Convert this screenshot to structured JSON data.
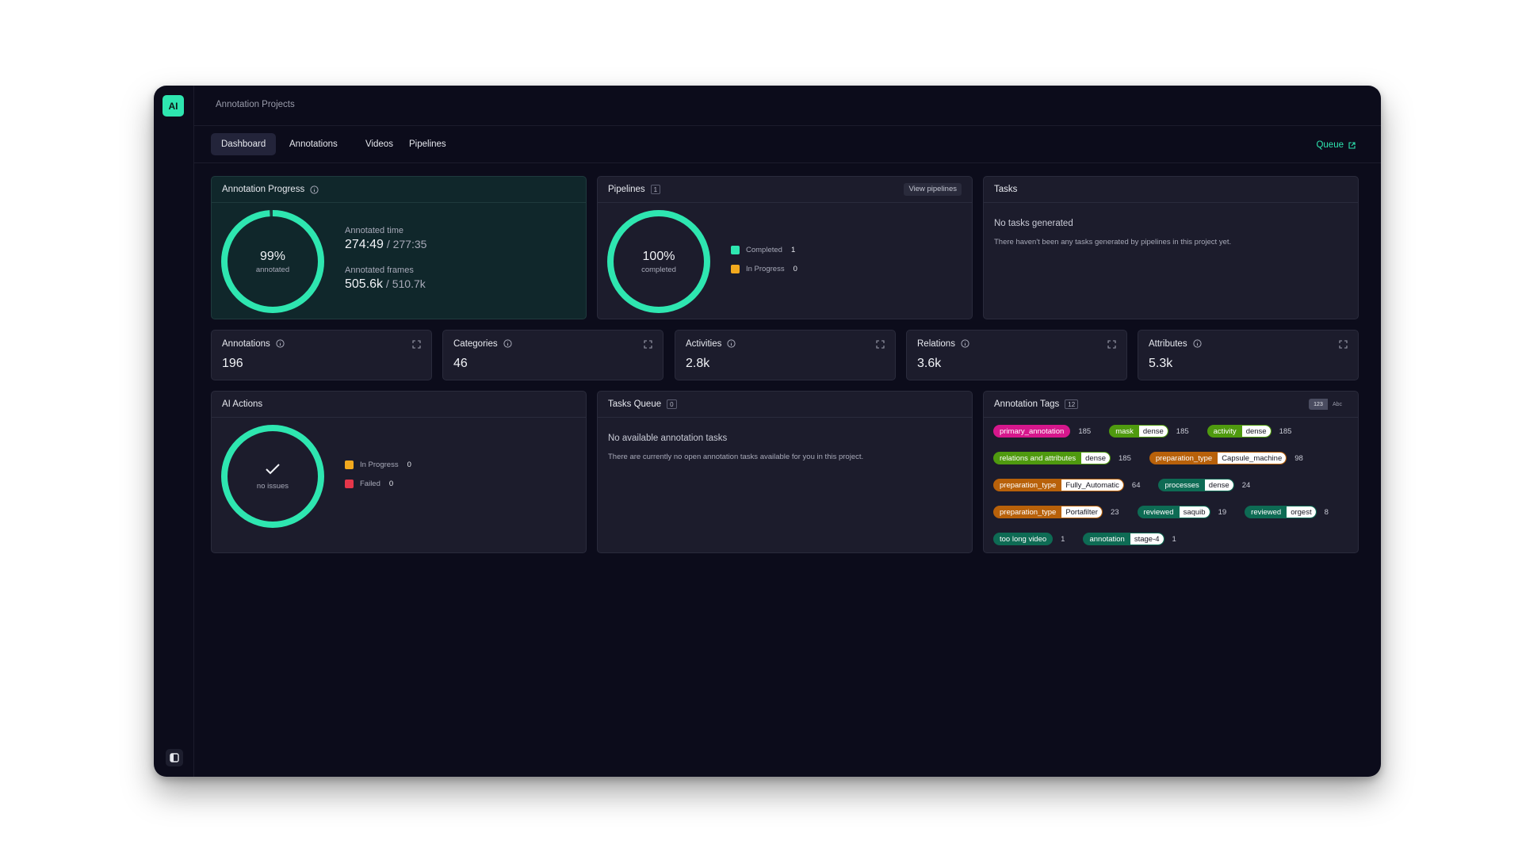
{
  "app": {
    "logo_text": "AI",
    "breadcrumb": "Annotation Projects"
  },
  "tabs": [
    {
      "label": "Dashboard",
      "active": true
    },
    {
      "label": "Annotations",
      "active": false
    },
    {
      "label": "Videos",
      "active": false
    },
    {
      "label": "Pipelines",
      "active": false
    }
  ],
  "queue_label": "Queue",
  "colors": {
    "accent": "#2ee6b0",
    "progress": "#f2a91e",
    "failed": "#e5364a",
    "ring_track": "#2a2b3c"
  },
  "annotation_progress": {
    "title": "Annotation Progress",
    "percent_text": "99%",
    "percent": 99,
    "caption": "annotated",
    "time_label": "Annotated time",
    "time_value": "274:49",
    "time_total": "277:35",
    "frames_label": "Annotated frames",
    "frames_value": "505.6k",
    "frames_total": "510.7k"
  },
  "pipelines": {
    "title": "Pipelines",
    "count": "1",
    "view_button": "View pipelines",
    "percent_text": "100%",
    "percent": 100,
    "caption": "completed",
    "legend": [
      {
        "label": "Completed",
        "value": "1",
        "color": "#2ee6b0"
      },
      {
        "label": "In Progress",
        "value": "0",
        "color": "#f2a91e"
      }
    ]
  },
  "tasks": {
    "title": "Tasks",
    "empty_title": "No tasks generated",
    "empty_desc": "There haven't been any tasks generated by pipelines in this project yet."
  },
  "metrics": [
    {
      "label": "Annotations",
      "value": "196"
    },
    {
      "label": "Categories",
      "value": "46"
    },
    {
      "label": "Activities",
      "value": "2.8k"
    },
    {
      "label": "Relations",
      "value": "3.6k"
    },
    {
      "label": "Attributes",
      "value": "5.3k"
    }
  ],
  "ai_actions": {
    "title": "AI Actions",
    "caption": "no issues",
    "legend": [
      {
        "label": "In Progress",
        "value": "0",
        "color": "#f2a91e"
      },
      {
        "label": "Failed",
        "value": "0",
        "color": "#e5364a"
      }
    ]
  },
  "tasks_queue": {
    "title": "Tasks Queue",
    "count": "0",
    "empty_title": "No available annotation tasks",
    "empty_desc": "There are currently no open annotation tasks available for you in this project."
  },
  "annotation_tags": {
    "title": "Annotation Tags",
    "count": "12",
    "toggle": [
      "123",
      "Abc"
    ],
    "rows": [
      [
        {
          "key": "primary_annotation",
          "value": null,
          "count": "185",
          "color": "#d6178c"
        },
        {
          "key": "mask",
          "value": "dense",
          "count": "185",
          "color": "#4f9a0f"
        },
        {
          "key": "activity",
          "value": "dense",
          "count": "185",
          "color": "#4f9a0f"
        }
      ],
      [
        {
          "key": "relations and attributes",
          "value": "dense",
          "count": "185",
          "color": "#4f9a0f"
        },
        {
          "key": "preparation_type",
          "value": "Capsule_machine",
          "count": "98",
          "color": "#b8610a"
        }
      ],
      [
        {
          "key": "preparation_type",
          "value": "Fully_Automatic",
          "count": "64",
          "color": "#b8610a"
        },
        {
          "key": "processes",
          "value": "dense",
          "count": "24",
          "color": "#0e6b54"
        }
      ],
      [
        {
          "key": "preparation_type",
          "value": "Portafilter",
          "count": "23",
          "color": "#b8610a"
        },
        {
          "key": "reviewed",
          "value": "saquib",
          "count": "19",
          "color": "#0e6b54"
        },
        {
          "key": "reviewed",
          "value": "orgest",
          "count": "8",
          "color": "#0e6b54"
        }
      ],
      [
        {
          "key": "too long video",
          "value": null,
          "count": "1",
          "color": "#0e6b54"
        },
        {
          "key": "annotation",
          "value": "stage-4",
          "count": "1",
          "color": "#0e6b54"
        }
      ]
    ]
  }
}
